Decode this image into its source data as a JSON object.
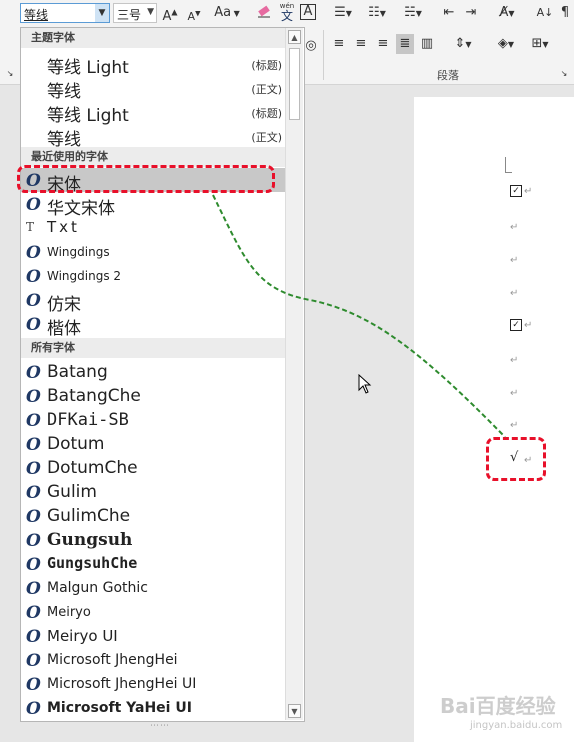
{
  "ribbon": {
    "font_value": "等线",
    "size_value": "三号",
    "wen_label": "wén",
    "wen_char": "文",
    "a_box": "A",
    "aa_label": "Aa",
    "paragraph_group_label": "段落"
  },
  "dropdown": {
    "sections": [
      {
        "header": "主题字体"
      },
      {
        "header": "最近使用的字体"
      },
      {
        "header": "所有字体"
      }
    ],
    "theme_fonts": [
      {
        "name": "等线 Light",
        "tag": "(标题)"
      },
      {
        "name": "等线",
        "tag": "(正文)"
      },
      {
        "name": "等线 Light",
        "tag": "(标题)"
      },
      {
        "name": "等线",
        "tag": "(正文)"
      }
    ],
    "recent_fonts": [
      "宋体",
      "华文宋体",
      "Txt",
      "Wingdings",
      "Wingdings 2",
      "仿宋",
      "楷体"
    ],
    "all_fonts": [
      "Batang",
      "BatangChe",
      "DFKai-SB",
      "Dotum",
      "DotumChe",
      "Gulim",
      "GulimChe",
      "Gungsuh",
      "GungsuhChe",
      "Malgun Gothic",
      "Meiryo",
      "Meiryo UI",
      "Microsoft JhengHei",
      "Microsoft JhengHei UI",
      "Microsoft YaHei UI"
    ],
    "selected_font": "宋体"
  },
  "document": {
    "result_char": "√"
  },
  "watermark": {
    "text": "Bai百度经验",
    "sub": "jingyan.baidu.com"
  },
  "colors": {
    "annotation_red": "#e8102a",
    "annotation_green": "#2e8b2e",
    "font_icon": "#1f3864"
  }
}
